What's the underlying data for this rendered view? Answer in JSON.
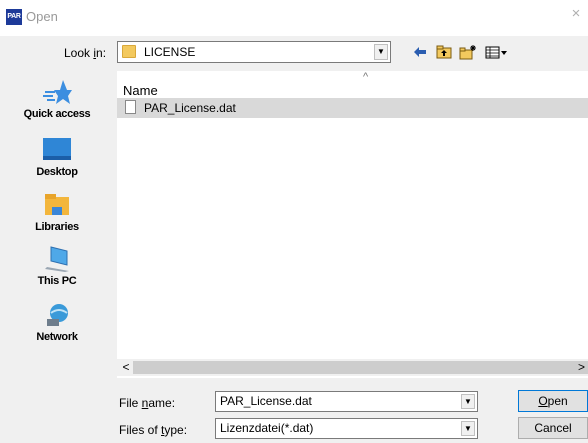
{
  "window": {
    "app_logo_text": "PAR",
    "title": "Open",
    "close_glyph": "×"
  },
  "lookin": {
    "label_pre": "Look ",
    "label_accel": "i",
    "label_post": "n:",
    "value": "LICENSE",
    "folder_icon": "folder-icon"
  },
  "toolbar": {
    "back_icon": "back-arrow-icon",
    "up_icon": "up-folder-icon",
    "new_folder_icon": "new-folder-icon",
    "views_icon": "view-menu-icon"
  },
  "places": [
    {
      "label": "Quick access",
      "icon": "star-icon"
    },
    {
      "label": "Desktop",
      "icon": "desktop-icon"
    },
    {
      "label": "Libraries",
      "icon": "libraries-icon"
    },
    {
      "label": "This PC",
      "icon": "computer-icon"
    },
    {
      "label": "Network",
      "icon": "network-icon"
    }
  ],
  "file_list": {
    "column_header": "Name",
    "files": [
      {
        "name": "PAR_License.dat",
        "icon": "file-icon",
        "selected": true
      }
    ]
  },
  "filename": {
    "label_pre": "File ",
    "label_accel": "n",
    "label_post": "ame:",
    "value": "PAR_License.dat"
  },
  "filetype": {
    "label_pre": "Files of ",
    "label_accel": "t",
    "label_post": "ype:",
    "value": "Lizenzdatei(*.dat)"
  },
  "buttons": {
    "open_accel": "O",
    "open_rest": "pen",
    "cancel": "Cancel"
  },
  "colors": {
    "accent": "#0078d7",
    "selection": "#d9d9d9",
    "folder": "#f3c95e"
  }
}
